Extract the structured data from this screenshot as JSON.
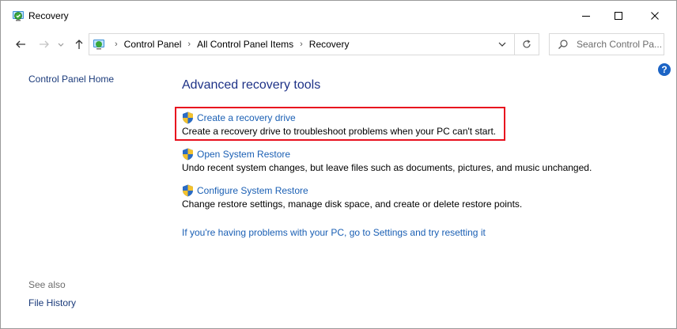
{
  "window": {
    "title": "Recovery"
  },
  "address": {
    "crumbs": [
      "Control Panel",
      "All Control Panel Items",
      "Recovery"
    ]
  },
  "search": {
    "placeholder": "Search Control Pa..."
  },
  "sidebar": {
    "home_link": "Control Panel Home",
    "see_also_label": "See also",
    "see_also_items": [
      "File History"
    ]
  },
  "main": {
    "heading": "Advanced recovery tools",
    "tasks": [
      {
        "title": "Create a recovery drive",
        "description": "Create a recovery drive to troubleshoot problems when your PC can't start."
      },
      {
        "title": "Open System Restore",
        "description": "Undo recent system changes, but leave files such as documents, pictures, and music unchanged."
      },
      {
        "title": "Configure System Restore",
        "description": "Change restore settings, manage disk space, and create or delete restore points."
      }
    ],
    "reset_link": "If you're having problems with your PC, go to Settings and try resetting it"
  },
  "help": {
    "glyph": "?"
  },
  "colors": {
    "link": "#1a5fb4",
    "heading": "#1e3287",
    "highlight": "#e8101e",
    "help_badge": "#1c64c5"
  },
  "icons": [
    "recovery-app-icon",
    "minimize-icon",
    "maximize-icon",
    "close-icon",
    "back-arrow-icon",
    "forward-arrow-icon",
    "recent-dropdown-icon",
    "up-arrow-icon",
    "control-panel-icon",
    "chevron-right-icon",
    "chevron-down-icon",
    "refresh-icon",
    "search-icon",
    "help-icon",
    "uac-shield-icon"
  ]
}
